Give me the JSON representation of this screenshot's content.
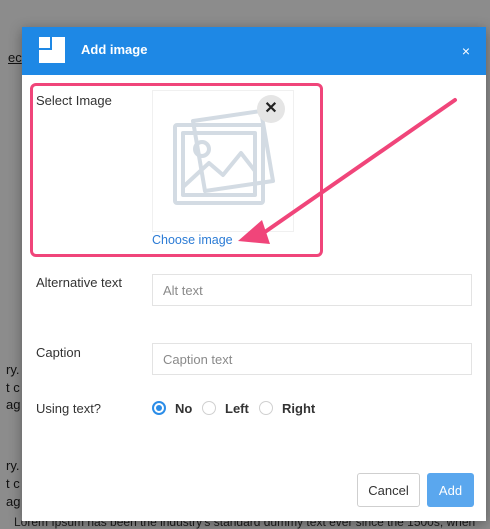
{
  "background": {
    "fragments": [
      "ec",
      "ry.",
      "t c",
      "ag",
      "ry.",
      "t c",
      "ag"
    ],
    "footer_text": "Lorem Ipsum has been the industry's standard dummy text ever since the 1500s, when"
  },
  "dialog": {
    "title": "Add image",
    "close_label": "×",
    "select_image_label": "Select Image",
    "remove_icon_label": "✕",
    "choose_image_link": "Choose image",
    "alt_label": "Alternative text",
    "alt_placeholder": "Alt text",
    "caption_label": "Caption",
    "caption_placeholder": "Caption text",
    "using_text_label": "Using text?",
    "radio_options": [
      {
        "label": "No",
        "checked": true
      },
      {
        "label": "Left",
        "checked": false
      },
      {
        "label": "Right",
        "checked": false
      }
    ],
    "cancel_button": "Cancel",
    "add_button": "Add"
  },
  "colors": {
    "header_blue": "#1e88e5",
    "highlight_pink": "#f0457a",
    "link_blue": "#2b7bd5",
    "add_button": "#5aa7ee"
  },
  "icons": [
    "app-logo-icon",
    "image-placeholder-icon",
    "remove-image-icon",
    "annotation-arrow"
  ]
}
